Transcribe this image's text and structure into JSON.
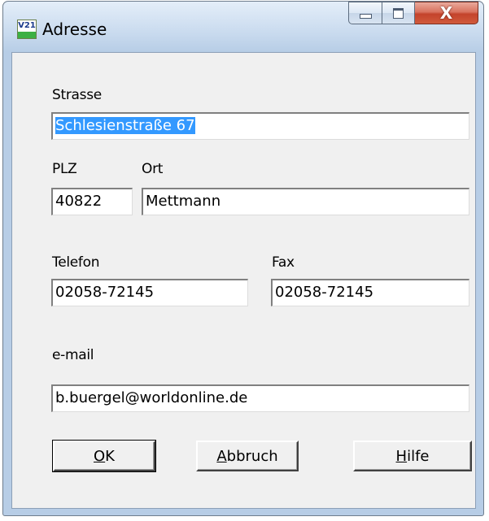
{
  "window": {
    "title": "Adresse",
    "app_icon": {
      "name": "v21-app-icon",
      "text": "V21"
    },
    "caption_buttons": {
      "minimize": {
        "icon": "minimize-icon"
      },
      "maximize": {
        "icon": "maximize-icon"
      },
      "close": {
        "icon": "close-icon",
        "glyph": "X"
      }
    }
  },
  "form": {
    "strasse": {
      "label": "Strasse",
      "value": "Schlesienstraße 67"
    },
    "plz": {
      "label": "PLZ",
      "value": "40822"
    },
    "ort": {
      "label": "Ort",
      "value": "Mettmann"
    },
    "telefon": {
      "label": "Telefon",
      "value": "02058-72145"
    },
    "fax": {
      "label": "Fax",
      "value": "02058-72145"
    },
    "email": {
      "label": "e-mail",
      "value": "b.buergel@worldonline.de"
    }
  },
  "buttons": {
    "ok": {
      "mnemonic": "O",
      "rest": "K"
    },
    "abbruch": {
      "mnemonic": "A",
      "rest": "bbruch"
    },
    "hilfe": {
      "mnemonic": "H",
      "rest": "ilfe"
    }
  },
  "colors": {
    "selection": "#3399ff",
    "client_bg": "#f0f0f0",
    "close_button": "#c4432b"
  }
}
